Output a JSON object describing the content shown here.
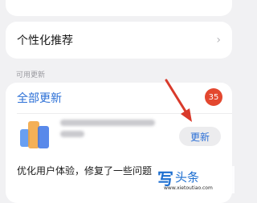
{
  "personalized_recommendations": {
    "label": "个性化推荐",
    "chevron": "›"
  },
  "available_updates": {
    "section_label": "可用更新",
    "all_updates_label": "全部更新",
    "count": "35",
    "app": {
      "icon": "app-icon",
      "update_button_label": "更新",
      "description": "优化用户体验，修复了一些问题"
    }
  },
  "watermark": {
    "mark": "写",
    "text": "头条",
    "url": "www.xietoutiao.com"
  },
  "colors": {
    "accent": "#2b6fd6",
    "badge": "#e3472f",
    "arrow": "#d93a2b",
    "background": "#f1f1f3"
  }
}
